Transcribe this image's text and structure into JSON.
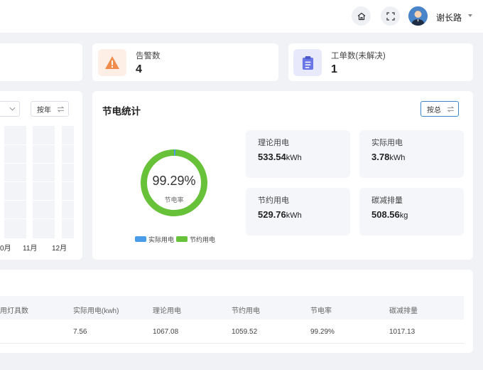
{
  "header": {
    "user_name": "谢长路",
    "icons": [
      "home-icon",
      "fullscreen-icon",
      "avatar",
      "caret-down-icon"
    ]
  },
  "stats": [
    {
      "label": "告警数",
      "value": "4",
      "icon": "warning-icon",
      "color": "#f08c4c"
    },
    {
      "label": "工单数(未解决)",
      "value": "1",
      "icon": "clipboard-icon",
      "color": "#6b76e6"
    }
  ],
  "left_chart": {
    "period_select": "按年",
    "month_labels": [
      "0月",
      "11月",
      "12月"
    ]
  },
  "energy": {
    "title": "节电统计",
    "mode_button": "按总",
    "donut": {
      "percent_text": "99.29%",
      "caption": "节电率",
      "actual_ratio": 0.0071
    },
    "legend": [
      "实际用电",
      "节约用电"
    ],
    "tiles": [
      {
        "label": "理论用电",
        "value": "533.54",
        "unit": "kWh"
      },
      {
        "label": "实际用电",
        "value": "3.78",
        "unit": "kWh"
      },
      {
        "label": "节约用电",
        "value": "529.76",
        "unit": "kWh"
      },
      {
        "label": "碳减排量",
        "value": "508.56",
        "unit": "kg"
      }
    ],
    "colors": {
      "actual": "#4a9be8",
      "saved": "#67c23a"
    }
  },
  "table": {
    "headers": [
      "用灯具数",
      "实际用电(kwh)",
      "理论用电",
      "节约用电",
      "节电率",
      "碳减排量"
    ],
    "rows": [
      [
        "",
        "7.56",
        "1067.08",
        "1059.52",
        "99.29%",
        "1017.13"
      ]
    ]
  }
}
